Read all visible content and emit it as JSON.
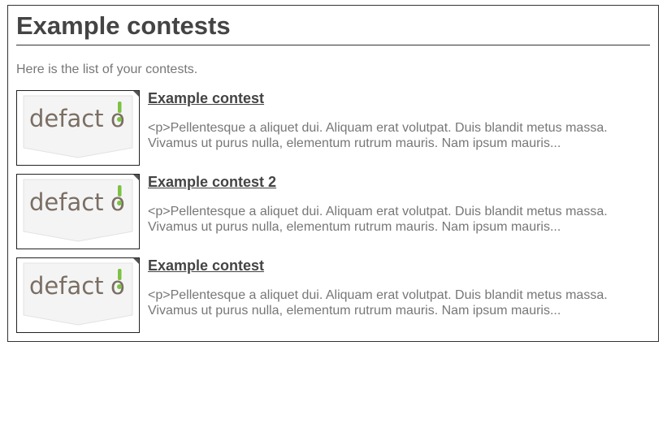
{
  "page": {
    "title": "Example contests",
    "intro": "Here is the list of your contests."
  },
  "logo": {
    "text_main": "defact",
    "text_end": "o",
    "main_color": "#7a6e64",
    "accent_color": "#7dc142"
  },
  "contests": [
    {
      "title": "Example contest",
      "description": "<p>Pellentesque a aliquet dui. Aliquam erat volutpat. Duis blandit metus massa. Vivamus ut purus nulla, elementum rutrum mauris. Nam ipsum mauris..."
    },
    {
      "title": "Example contest 2",
      "description": "<p>Pellentesque a aliquet dui. Aliquam erat volutpat. Duis blandit metus massa. Vivamus ut purus nulla, elementum rutrum mauris. Nam ipsum mauris..."
    },
    {
      "title": "Example contest",
      "description": "<p>Pellentesque a aliquet dui. Aliquam erat volutpat. Duis blandit metus massa. Vivamus ut purus nulla, elementum rutrum mauris. Nam ipsum mauris..."
    }
  ]
}
